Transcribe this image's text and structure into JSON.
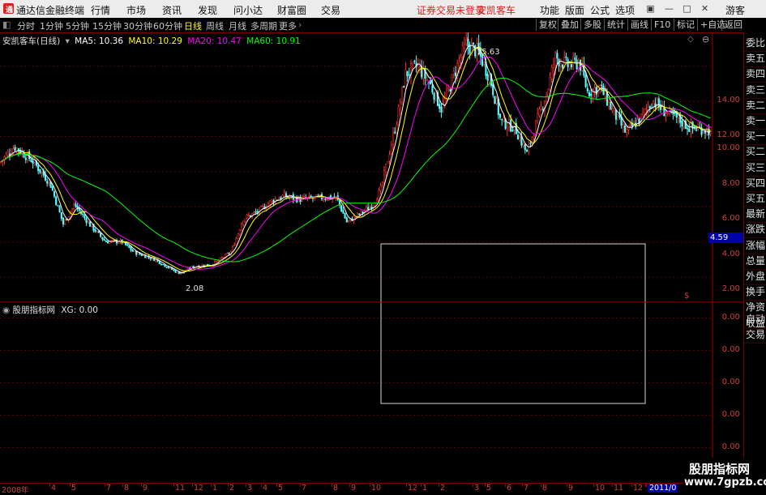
{
  "app": {
    "title": "通达信金融终端",
    "menus": [
      "行情",
      "市场",
      "资讯",
      "发现",
      "问小达",
      "财富圈",
      "交易"
    ],
    "notice": "证券交易未登录",
    "stock_name_top": "安凯客车",
    "right_menus": [
      "功能",
      "版面",
      "公式",
      "选项"
    ],
    "guest": "游客"
  },
  "toolbar": {
    "periods": [
      "分时",
      "1分钟",
      "5分钟",
      "15分钟",
      "30分钟",
      "60分钟",
      "日线",
      "周线",
      "月线",
      "多周期",
      "更多"
    ],
    "selected": "日线",
    "right_buttons": [
      "复权",
      "叠加",
      "多股",
      "统计",
      "画线",
      "F10",
      "标记",
      "+自选",
      "返回"
    ]
  },
  "main_legend": {
    "title": "安凯客车(日线)",
    "ma5": "MA5: 10.36",
    "ma10": "MA10: 10.29",
    "ma20": "MA20: 10.47",
    "ma60": "MA60: 10.91",
    "colors": {
      "ma5": "#ffffff",
      "ma10": "#ffff00",
      "ma20": "#ff00ff",
      "ma60": "#00ff00",
      "up": "#ff3232",
      "down": "#54ffff"
    }
  },
  "sub_legend": {
    "title": "股朋指标网",
    "xg": "XG: 0.00"
  },
  "annotations": {
    "high": "15.63",
    "low": "2.08",
    "current_price_tag": "4.59"
  },
  "price_axis": [
    "14.00",
    "12.00",
    "10.00",
    "8.00",
    "6.00",
    "4.00",
    "2.00"
  ],
  "sub_axis": [
    "0.00",
    "0.00",
    "0.00",
    "0.00",
    "0.00"
  ],
  "dates": [
    "2008年",
    "4",
    "5",
    "7",
    "8",
    "9",
    "11",
    "12",
    "1",
    "2",
    "3",
    "4",
    "5",
    "7",
    "8",
    "9",
    "10",
    "12",
    "1",
    "2",
    "3",
    "5",
    "6",
    "7",
    "8",
    "9",
    "10",
    "11",
    "12",
    "2",
    "2011/0"
  ],
  "right_panel": [
    "委比",
    "卖五",
    "卖四",
    "卖三",
    "卖二",
    "卖一",
    "买一",
    "买二",
    "买三",
    "买四",
    "买五",
    "最新",
    "涨跌",
    "涨幅",
    "总量",
    "外盘",
    "换手",
    "净资",
    "收益",
    "自动",
    "交易"
  ],
  "watermark": {
    "line1": "股朋指标网",
    "line2": "www.7gpzb.com"
  }
}
